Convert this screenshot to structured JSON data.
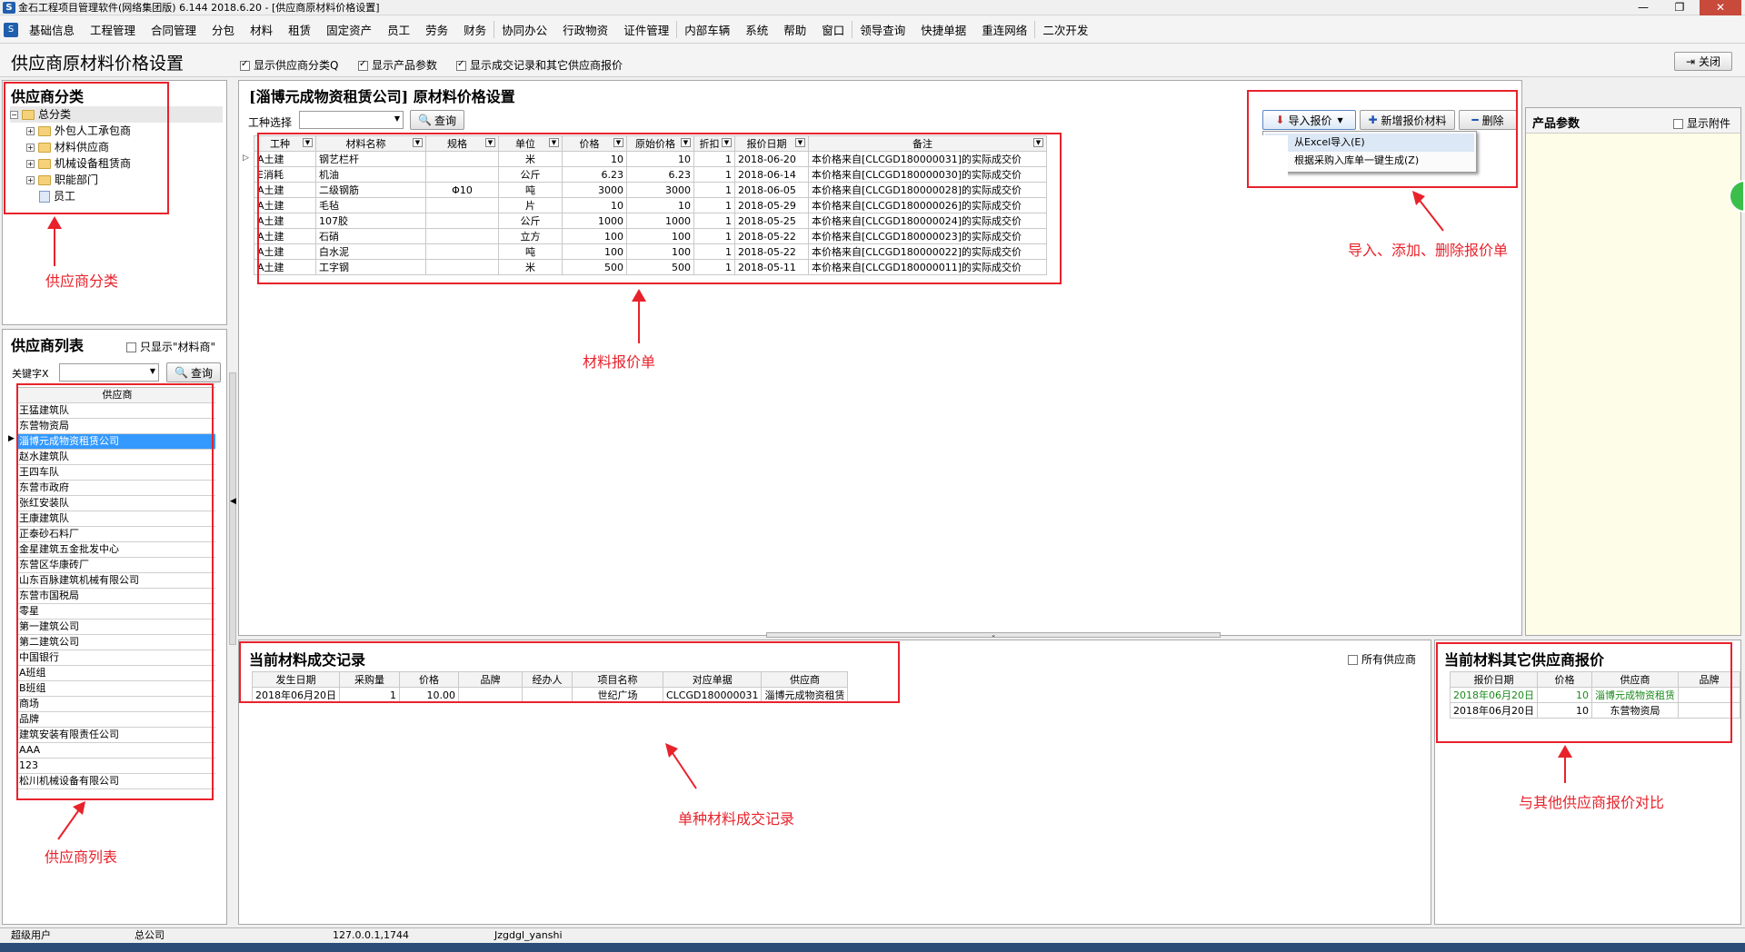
{
  "window": {
    "title": "金石工程项目管理软件(网络集团版) 6.144  2018.6.20 - [供应商原材料价格设置]",
    "logo": "S"
  },
  "menu": [
    "基础信息",
    "工程管理",
    "合同管理",
    "分包",
    "材料",
    "租赁",
    "固定资产",
    "员工",
    "劳务",
    "财务",
    "协同办公",
    "行政物资",
    "证件管理",
    "内部车辆",
    "系统",
    "帮助",
    "窗口",
    "领导查询",
    "快捷单据",
    "重连网络",
    "二次开发"
  ],
  "toolbar": {
    "page_title": "供应商原材料价格设置",
    "check1": "显示供应商分类Q",
    "check2": "显示产品参数",
    "check3": "显示成交记录和其它供应商报价",
    "close": "关闭"
  },
  "category": {
    "title": "供应商分类",
    "root": "总分类",
    "items": [
      "外包人工承包商",
      "材料供应商",
      "机械设备租赁商",
      "职能部门"
    ],
    "leaf": "员工"
  },
  "supplier_list": {
    "title": "供应商列表",
    "only_material": "只显示\"材料商\"",
    "keyword_label": "关键字X",
    "query": "查询",
    "col": "供应商",
    "rows": [
      "王猛建筑队",
      "东营物资局",
      "淄博元成物资租赁公司",
      "赵水建筑队",
      "王四车队",
      "东营市政府",
      "张红安装队",
      "王康建筑队",
      "正泰砂石料厂",
      "金星建筑五金批发中心",
      "东营区华康砖厂",
      "山东百脉建筑机械有限公司",
      "东营市国税局",
      "零星",
      "第一建筑公司",
      "第二建筑公司",
      "中国银行",
      "A班组",
      "B班组",
      "商场",
      "品牌",
      "建筑安装有限责任公司",
      "AAA",
      "123",
      "松川机械设备有限公司"
    ],
    "selected": 2
  },
  "price": {
    "title": "[淄博元成物资租赁公司] 原材料价格设置",
    "trade_label": "工种选择",
    "query": "查询",
    "import_btn": "导入报价",
    "add_btn": "新增报价材料",
    "delete_btn": "删除",
    "menu_excel": "从Excel导入(E)",
    "menu_purchase": "根据采购入库单一键生成(Z)",
    "columns": [
      "工种",
      "材料名称",
      "规格",
      "单位",
      "价格",
      "原始价格",
      "折扣",
      "报价日期",
      "备注"
    ],
    "rows": [
      [
        "A土建",
        "钢艺栏杆",
        "",
        "米",
        "10",
        "10",
        "1",
        "2018-06-20",
        "本价格来自[CLCGD180000031]的实际成交价"
      ],
      [
        "E消耗",
        "机油",
        "",
        "公斤",
        "6.23",
        "6.23",
        "1",
        "2018-06-14",
        "本价格来自[CLCGD180000030]的实际成交价"
      ],
      [
        "A土建",
        "二级钢筋",
        "Φ10",
        "吨",
        "3000",
        "3000",
        "1",
        "2018-06-05",
        "本价格来自[CLCGD180000028]的实际成交价"
      ],
      [
        "A土建",
        "毛毡",
        "",
        "片",
        "10",
        "10",
        "1",
        "2018-05-29",
        "本价格来自[CLCGD180000026]的实际成交价"
      ],
      [
        "A土建",
        "107胶",
        "",
        "公斤",
        "1000",
        "1000",
        "1",
        "2018-05-25",
        "本价格来自[CLCGD180000024]的实际成交价"
      ],
      [
        "A土建",
        "石硝",
        "",
        "立方",
        "100",
        "100",
        "1",
        "2018-05-22",
        "本价格来自[CLCGD180000023]的实际成交价"
      ],
      [
        "A土建",
        "白水泥",
        "",
        "吨",
        "100",
        "100",
        "1",
        "2018-05-22",
        "本价格来自[CLCGD180000022]的实际成交价"
      ],
      [
        "A土建",
        "工字钢",
        "",
        "米",
        "500",
        "500",
        "1",
        "2018-05-11",
        "本价格来自[CLCGD180000011]的实际成交价"
      ]
    ]
  },
  "params": {
    "title": "产品参数",
    "show_attach": "显示附件"
  },
  "transactions": {
    "title": "当前材料成交记录",
    "all_suppliers": "所有供应商",
    "columns": [
      "发生日期",
      "采购量",
      "价格",
      "品牌",
      "经办人",
      "项目名称",
      "对应单据",
      "供应商"
    ],
    "rows": [
      [
        "2018年06月20日",
        "1",
        "10.00",
        "",
        "",
        "世纪广场",
        "CLCGD180000031",
        "淄博元成物资租赁"
      ]
    ]
  },
  "others": {
    "title": "当前材料其它供应商报价",
    "columns": [
      "报价日期",
      "价格",
      "供应商",
      "品牌"
    ],
    "rows": [
      [
        "2018年06月20日",
        "10",
        "淄博元成物资租赁",
        ""
      ],
      [
        "2018年06月20日",
        "10",
        "东营物资局",
        ""
      ]
    ]
  },
  "annotations": {
    "category": "供应商分类",
    "price_sheet": "材料报价单",
    "import_add_delete": "导入、添加、删除报价单",
    "supplier_list": "供应商列表",
    "single_record": "单种材料成交记录",
    "compare": "与其他供应商报价对比"
  },
  "status": {
    "user": "超级用户",
    "company": "总公司",
    "ip": "127.0.0.1,1744",
    "db": "Jzgdgl_yanshi"
  },
  "colors": {
    "annotation": "#e8222b",
    "selection": "#3399ff",
    "green_text": "#1a8a1a"
  }
}
